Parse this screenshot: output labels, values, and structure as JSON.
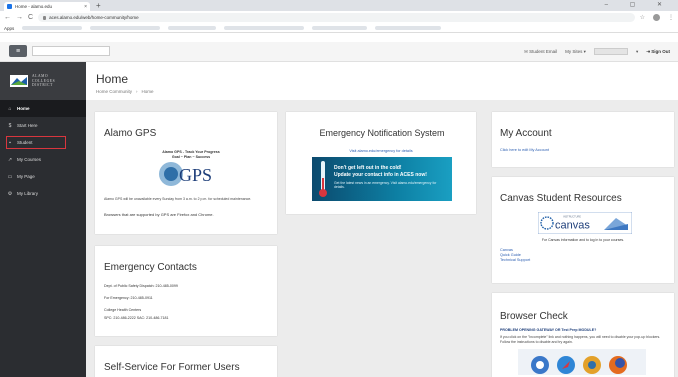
{
  "browser": {
    "tab_title": "Home - alamo.edu",
    "tab_close": "×",
    "new_tab": "+",
    "window_controls": "– ▢ ✕",
    "nav_back": "←",
    "nav_forward": "→",
    "nav_reload": "C",
    "url": "aces.alamo.edu/web/home-community/home",
    "star": "☆",
    "apps_label": "Apps"
  },
  "header": {
    "menu_icon": "≡",
    "email_link": "Student Email",
    "my_sites": "My Sites ▾",
    "dropdown_caret": "▾",
    "signout_icon": "⇥",
    "sign_out": "Sign Out"
  },
  "logo": {
    "line1": "ALAMO",
    "line2": "COLLEGES",
    "line3": "DISTRICT",
    "colors": {
      "blue": "#1e5fa8",
      "green": "#5aa83c"
    }
  },
  "sidebar": {
    "items": [
      {
        "icon": "⌂",
        "label": "Home",
        "active": true
      },
      {
        "icon": "$",
        "label": "Start Here",
        "active": false
      },
      {
        "icon": "▪",
        "label": "Student",
        "active": false,
        "boxed": true
      },
      {
        "icon": "↗",
        "label": "My Courses",
        "active": false
      },
      {
        "icon": "▭",
        "label": "My Page",
        "active": false
      },
      {
        "icon": "⚙",
        "label": "My Library",
        "active": false
      }
    ]
  },
  "page": {
    "title": "Home",
    "breadcrumbs": [
      "Home Community",
      "Home"
    ]
  },
  "gps": {
    "title": "Alamo GPS",
    "tagline1": "Alamo GPS - Track Your Progress",
    "tagline2": "Goal ~ Plan ~ Success",
    "logo_text": "GPS",
    "note": "Alamo GPS will be unavailable every Sunday from 3 a.m. to 2 p.m. for scheduled maintenance.",
    "browsers": "Browsers that are supported by GPS are Firefox and Chrome."
  },
  "ens": {
    "title": "Emergency Notification System",
    "visit": "Visit alamo.edu/emergency for details",
    "banner_line1": "Don't get left out in the cold!",
    "banner_line2": "Update your contact info in ACES now!",
    "banner_line3": "Get the latest news in an emergency. Visit alamo.edu/emergency for details."
  },
  "account": {
    "title": "My Account",
    "link": "Click here to edit My Account"
  },
  "canvas": {
    "title": "Canvas Student Resources",
    "logo_text": "canvas",
    "logo_small": "INSTRUCTURE",
    "info": "For Canvas information and to log in to your courses.",
    "links": [
      "Canvas",
      "Quick Guide",
      "Technical Support"
    ]
  },
  "emergency": {
    "title": "Emergency Contacts",
    "lines": [
      "Dept. of Public Safety Dispatch: 210-485-0099",
      "For Emergency: 210-485-0911",
      "College Health Centers",
      "SPC: 210-486-2222     SAC: 210-486-7181"
    ]
  },
  "selfservice": {
    "title": "Self-Service For Former Users"
  },
  "browsercheck": {
    "title": "Browser Check",
    "warning": "PROBLEM OPENING GATEWAY OR Test Prep MODULE?",
    "desc": "If you click on the \"Incomplete\" link and nothing happens, you will need to disable your pop-up blockers. Follow the instructions to disable and try again."
  }
}
